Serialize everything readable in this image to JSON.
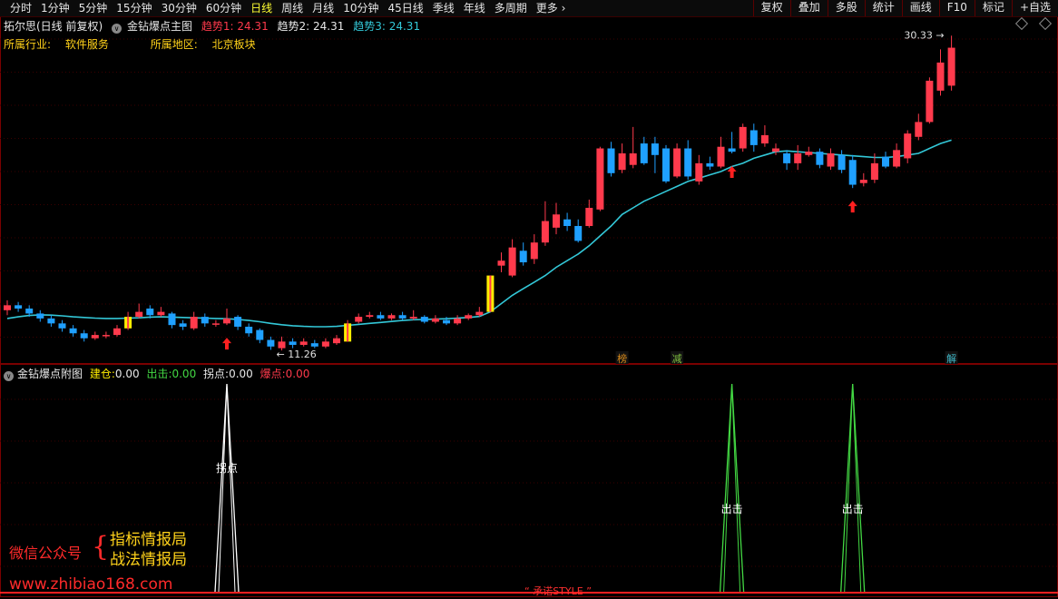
{
  "toolbar": {
    "periods": [
      "分时",
      "1分钟",
      "5分钟",
      "15分钟",
      "30分钟",
      "60分钟",
      "日线",
      "周线",
      "月线",
      "10分钟",
      "45日线",
      "季线",
      "年线",
      "多周期",
      "更多"
    ],
    "active_period": "日线",
    "tools": [
      "复权",
      "叠加",
      "多股",
      "统计",
      "画线",
      "F10",
      "标记",
      "+自选"
    ]
  },
  "stock": {
    "title": "拓尔思(日线 前复权)",
    "main_indicator": "金钻爆点主图",
    "trend1": "趋势1: 24.31",
    "trend2": "趋势2: 24.31",
    "trend3": "趋势3: 24.31",
    "industry_label": "所属行业:",
    "industry": "软件服务",
    "region_label": "所属地区:",
    "region": "北京板块"
  },
  "sub_indicator": {
    "name": "金钻爆点附图",
    "build_label": "建仓:",
    "build_value": "0.00",
    "exit_label": "出击:",
    "exit_value": "0.00",
    "turn_label": "拐点:",
    "turn_value": "0.00",
    "burst_label": "爆点:",
    "burst_value": "0.00"
  },
  "colors": {
    "up": "#ff3a4c",
    "down": "#1fa0ff",
    "ma": "#33c8d8",
    "buy_arrow": "#ff2020",
    "turn_signal": "#ffffff",
    "exit_signal": "#43d843",
    "burst_bar": "#ffee00"
  },
  "watermark": {
    "wechat": "微信公众号",
    "line1": "指标情报局",
    "line2": "战法情报局",
    "url": "www.zhibiao168.com",
    "style_tag": "“ 承诺STYLE ”"
  },
  "chart_data": {
    "type": "candlestick",
    "y_range": [
      10.5,
      31.5
    ],
    "high_label": "30.33",
    "low_label": "11.26",
    "candles": [
      {
        "o": 13.7,
        "c": 14.0,
        "h": 14.3,
        "l": 13.4
      },
      {
        "o": 14.0,
        "c": 13.8,
        "h": 14.2,
        "l": 13.6
      },
      {
        "o": 13.8,
        "c": 13.5,
        "h": 14.0,
        "l": 13.3
      },
      {
        "o": 13.5,
        "c": 13.2,
        "h": 13.7,
        "l": 13.0
      },
      {
        "o": 13.2,
        "c": 12.9,
        "h": 13.4,
        "l": 12.7
      },
      {
        "o": 12.9,
        "c": 12.6,
        "h": 13.1,
        "l": 12.4
      },
      {
        "o": 12.6,
        "c": 12.3,
        "h": 12.8,
        "l": 12.1
      },
      {
        "o": 12.3,
        "c": 12.0,
        "h": 12.5,
        "l": 11.8
      },
      {
        "o": 12.0,
        "c": 12.2,
        "h": 12.4,
        "l": 11.9
      },
      {
        "o": 12.2,
        "c": 12.2,
        "h": 12.4,
        "l": 12.0
      },
      {
        "o": 12.2,
        "c": 12.6,
        "h": 12.8,
        "l": 12.1
      },
      {
        "o": 12.6,
        "c": 13.3,
        "h": 13.6,
        "l": 12.5
      },
      {
        "o": 13.3,
        "c": 13.6,
        "h": 14.1,
        "l": 13.2
      },
      {
        "o": 13.8,
        "c": 13.4,
        "h": 14.0,
        "l": 13.2
      },
      {
        "o": 13.4,
        "c": 13.6,
        "h": 13.9,
        "l": 13.3
      },
      {
        "o": 13.5,
        "c": 12.8,
        "h": 13.6,
        "l": 12.6
      },
      {
        "o": 12.9,
        "c": 12.7,
        "h": 13.1,
        "l": 12.5
      },
      {
        "o": 12.6,
        "c": 13.3,
        "h": 13.6,
        "l": 12.5
      },
      {
        "o": 13.3,
        "c": 12.9,
        "h": 13.5,
        "l": 12.7
      },
      {
        "o": 12.9,
        "c": 12.9,
        "h": 13.1,
        "l": 12.7
      },
      {
        "o": 12.9,
        "c": 13.2,
        "h": 13.8,
        "l": 12.8
      },
      {
        "o": 13.3,
        "c": 12.7,
        "h": 13.4,
        "l": 12.5
      },
      {
        "o": 12.7,
        "c": 12.3,
        "h": 12.9,
        "l": 12.1
      },
      {
        "o": 12.5,
        "c": 11.9,
        "h": 12.6,
        "l": 11.7
      },
      {
        "o": 11.9,
        "c": 11.5,
        "h": 12.1,
        "l": 11.3
      },
      {
        "o": 11.4,
        "c": 11.8,
        "h": 12.1,
        "l": 11.26
      },
      {
        "o": 11.8,
        "c": 11.6,
        "h": 12.0,
        "l": 11.4
      },
      {
        "o": 11.6,
        "c": 11.8,
        "h": 12.0,
        "l": 11.5
      },
      {
        "o": 11.7,
        "c": 11.5,
        "h": 11.9,
        "l": 11.4
      },
      {
        "o": 11.5,
        "c": 11.8,
        "h": 12.0,
        "l": 11.4
      },
      {
        "o": 11.7,
        "c": 12.0,
        "h": 12.2,
        "l": 11.6
      },
      {
        "o": 11.8,
        "c": 12.9,
        "h": 13.1,
        "l": 11.8
      },
      {
        "o": 13.0,
        "c": 13.3,
        "h": 13.5,
        "l": 12.9
      },
      {
        "o": 13.3,
        "c": 13.4,
        "h": 13.6,
        "l": 13.2
      },
      {
        "o": 13.4,
        "c": 13.2,
        "h": 13.6,
        "l": 13.1
      },
      {
        "o": 13.2,
        "c": 13.4,
        "h": 13.5,
        "l": 13.1
      },
      {
        "o": 13.4,
        "c": 13.2,
        "h": 13.6,
        "l": 13.1
      },
      {
        "o": 13.2,
        "c": 13.3,
        "h": 13.7,
        "l": 13.1
      },
      {
        "o": 13.3,
        "c": 13.0,
        "h": 13.4,
        "l": 12.9
      },
      {
        "o": 13.0,
        "c": 13.2,
        "h": 13.4,
        "l": 12.9
      },
      {
        "o": 13.1,
        "c": 12.9,
        "h": 13.3,
        "l": 12.8
      },
      {
        "o": 12.9,
        "c": 13.2,
        "h": 13.4,
        "l": 12.8
      },
      {
        "o": 13.2,
        "c": 13.4,
        "h": 13.5,
        "l": 13.1
      },
      {
        "o": 13.4,
        "c": 13.6,
        "h": 13.9,
        "l": 13.3
      },
      {
        "o": 13.6,
        "c": 15.8,
        "h": 15.8,
        "l": 13.6
      },
      {
        "o": 16.4,
        "c": 16.7,
        "h": 17.2,
        "l": 16.0
      },
      {
        "o": 15.8,
        "c": 17.5,
        "h": 18.0,
        "l": 15.7
      },
      {
        "o": 17.3,
        "c": 16.6,
        "h": 17.8,
        "l": 16.4
      },
      {
        "o": 16.8,
        "c": 17.8,
        "h": 18.3,
        "l": 16.5
      },
      {
        "o": 17.8,
        "c": 19.1,
        "h": 20.3,
        "l": 17.6
      },
      {
        "o": 18.7,
        "c": 19.5,
        "h": 20.2,
        "l": 18.3
      },
      {
        "o": 19.2,
        "c": 18.8,
        "h": 19.6,
        "l": 18.5
      },
      {
        "o": 18.8,
        "c": 17.9,
        "h": 19.2,
        "l": 17.8
      },
      {
        "o": 18.8,
        "c": 19.9,
        "h": 20.4,
        "l": 18.7
      },
      {
        "o": 19.8,
        "c": 23.5,
        "h": 23.6,
        "l": 19.7
      },
      {
        "o": 23.5,
        "c": 22.0,
        "h": 23.9,
        "l": 21.8
      },
      {
        "o": 22.2,
        "c": 23.2,
        "h": 23.8,
        "l": 22.0
      },
      {
        "o": 22.5,
        "c": 23.2,
        "h": 24.8,
        "l": 22.3
      },
      {
        "o": 23.8,
        "c": 22.6,
        "h": 24.2,
        "l": 22.5
      },
      {
        "o": 23.8,
        "c": 23.1,
        "h": 24.2,
        "l": 22.0
      },
      {
        "o": 23.5,
        "c": 21.5,
        "h": 23.7,
        "l": 21.4
      },
      {
        "o": 21.8,
        "c": 23.5,
        "h": 23.8,
        "l": 21.7
      },
      {
        "o": 23.5,
        "c": 21.8,
        "h": 24.0,
        "l": 21.6
      },
      {
        "o": 21.5,
        "c": 22.6,
        "h": 23.1,
        "l": 21.3
      },
      {
        "o": 22.6,
        "c": 22.4,
        "h": 23.0,
        "l": 22.2
      },
      {
        "o": 22.4,
        "c": 23.6,
        "h": 24.2,
        "l": 22.3
      },
      {
        "o": 23.5,
        "c": 23.3,
        "h": 24.5,
        "l": 23.2
      },
      {
        "o": 23.5,
        "c": 24.8,
        "h": 25.0,
        "l": 23.3
      },
      {
        "o": 24.6,
        "c": 23.7,
        "h": 25.0,
        "l": 23.3
      },
      {
        "o": 23.8,
        "c": 24.3,
        "h": 24.9,
        "l": 23.6
      },
      {
        "o": 23.3,
        "c": 23.5,
        "h": 23.8,
        "l": 23.1
      },
      {
        "o": 23.2,
        "c": 22.6,
        "h": 23.4,
        "l": 22.2
      },
      {
        "o": 22.6,
        "c": 23.2,
        "h": 23.7,
        "l": 22.2
      },
      {
        "o": 23.1,
        "c": 23.3,
        "h": 23.6,
        "l": 23.0
      },
      {
        "o": 23.3,
        "c": 22.5,
        "h": 23.5,
        "l": 22.3
      },
      {
        "o": 22.4,
        "c": 23.2,
        "h": 23.5,
        "l": 22.2
      },
      {
        "o": 23.1,
        "c": 22.2,
        "h": 23.4,
        "l": 22.0
      },
      {
        "o": 22.8,
        "c": 21.3,
        "h": 23.1,
        "l": 21.1
      },
      {
        "o": 21.4,
        "c": 21.6,
        "h": 22.0,
        "l": 21.2
      },
      {
        "o": 21.6,
        "c": 22.6,
        "h": 23.2,
        "l": 21.4
      },
      {
        "o": 23.0,
        "c": 22.4,
        "h": 23.3,
        "l": 22.3
      },
      {
        "o": 22.4,
        "c": 23.4,
        "h": 23.8,
        "l": 22.3
      },
      {
        "o": 22.9,
        "c": 24.4,
        "h": 24.6,
        "l": 22.6
      },
      {
        "o": 24.2,
        "c": 25.1,
        "h": 25.6,
        "l": 24.0
      },
      {
        "o": 25.1,
        "c": 27.6,
        "h": 27.8,
        "l": 25.0
      },
      {
        "o": 27.0,
        "c": 28.7,
        "h": 29.5,
        "l": 26.7
      },
      {
        "o": 27.3,
        "c": 29.6,
        "h": 30.33,
        "l": 27.0
      }
    ],
    "burst_candles": [
      11,
      31,
      44
    ],
    "ma": [
      13.2,
      13.3,
      13.38,
      13.42,
      13.4,
      13.36,
      13.3,
      13.26,
      13.22,
      13.2,
      13.2,
      13.22,
      13.24,
      13.28,
      13.3,
      13.28,
      13.26,
      13.24,
      13.22,
      13.2,
      13.18,
      13.14,
      13.08,
      13.0,
      12.9,
      12.82,
      12.76,
      12.72,
      12.7,
      12.7,
      12.72,
      12.78,
      12.84,
      12.9,
      12.96,
      13.02,
      13.08,
      13.12,
      13.14,
      13.16,
      13.18,
      13.22,
      13.26,
      13.32,
      13.6,
      14.1,
      14.6,
      15.0,
      15.4,
      15.8,
      16.3,
      16.7,
      17.1,
      17.6,
      18.2,
      18.8,
      19.5,
      19.9,
      20.3,
      20.6,
      20.9,
      21.2,
      21.5,
      21.7,
      21.9,
      22.1,
      22.4,
      22.6,
      22.9,
      23.1,
      23.3,
      23.35,
      23.3,
      23.25,
      23.2,
      23.15,
      23.1,
      23.05,
      23.0,
      22.95,
      22.95,
      23.0,
      23.1,
      23.2,
      23.5,
      23.8,
      24.0
    ],
    "buy_arrows": [
      20,
      66,
      77
    ],
    "zones": [
      {
        "label": "榜",
        "candle": 56,
        "color": "#d88a1a"
      },
      {
        "label": "减",
        "candle": 61,
        "color": "#7fbf3f"
      },
      {
        "label": "解",
        "candle": 86,
        "color": "#3fb8c8"
      }
    ],
    "sub_signals": [
      {
        "label": "拐点",
        "candle": 20,
        "color": "#ffffff"
      },
      {
        "label": "出击",
        "candle": 66,
        "color": "#43d843"
      },
      {
        "label": "出击",
        "candle": 77,
        "color": "#43d843"
      }
    ]
  }
}
